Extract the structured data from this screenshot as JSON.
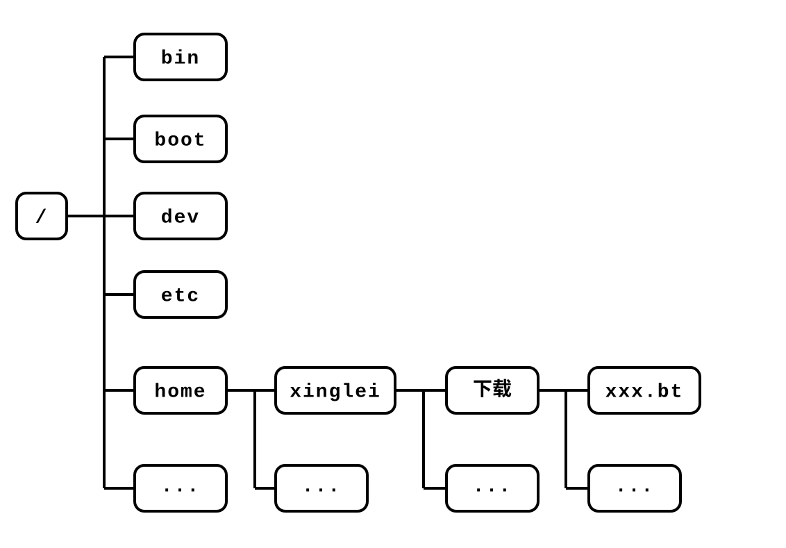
{
  "nodes": {
    "root": "/",
    "bin": "bin",
    "boot": "boot",
    "dev": "dev",
    "etc": "etc",
    "home": "home",
    "root_ellipsis": "...",
    "xinglei": "xinglei",
    "home_ellipsis": "...",
    "download": "下载",
    "xinglei_ellipsis": "...",
    "xxxbt": "xxx.bt",
    "download_ellipsis": "..."
  },
  "colors": {
    "stroke": "#000000",
    "fill": "#ffffff"
  }
}
